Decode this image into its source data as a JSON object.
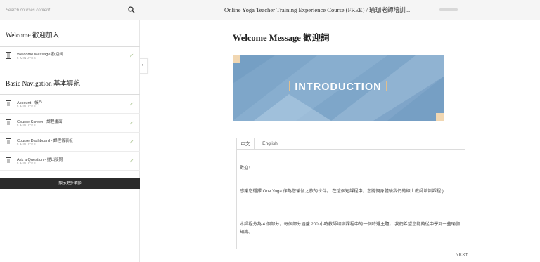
{
  "search": {
    "placeholder": "Search courses content"
  },
  "header": {
    "course_title": "Online Yoga Teacher Training Experience Course (FREE) / 瑜珈老師培訓...",
    "progress_percent": 0
  },
  "sidebar": {
    "sections": [
      {
        "title": "Welcome 歡迎加入",
        "lessons": [
          {
            "title": "Welcome Message 歡迎詞",
            "duration": "5 MINUTES"
          }
        ]
      },
      {
        "title": "Basic Navigation 基本導航",
        "lessons": [
          {
            "title": "Account - 帳戶",
            "duration": "5 MINUTES"
          },
          {
            "title": "Course Screen - 課程畫面",
            "duration": "5 MINUTES"
          },
          {
            "title": "Course Dashboard - 課程儀表板",
            "duration": "5 MINUTES"
          },
          {
            "title": "Ask a Question - 提出疑問",
            "duration": "5 MINUTES"
          }
        ]
      }
    ],
    "more_button": "顯示更多單節"
  },
  "main": {
    "lesson_title": "Welcome Message 歡迎詞",
    "banner_text": "INTRODUCTION",
    "tabs": [
      {
        "label": "中文",
        "active": true
      },
      {
        "label": "English",
        "active": false
      }
    ],
    "paragraphs": [
      "歡迎！",
      "感謝您選擇 One Yoga 作為您瑜伽之旅的伙伴。 在這個短課程中，您將親身體驗我們的線上教師培訓課程:)",
      "本課程分為 4 個部分，每個部分涵蓋 200 小時教師培訓課程中的一個時選主題。 我們希望您能夠從中學到一些瑜伽知識。"
    ],
    "next_label": "NEXT"
  },
  "colors": {
    "banner": "#7ea6c9",
    "accent": "#f1d7b2",
    "check": "#a6c18a",
    "button": "#2b2b2b"
  }
}
